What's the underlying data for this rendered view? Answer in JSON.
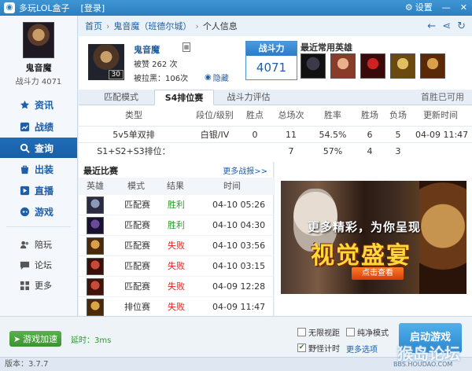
{
  "titlebar": {
    "title": "多玩LOL盒子",
    "login": "[登录]",
    "settings_label": "设置",
    "minimize": "—",
    "close": "✕"
  },
  "sidebar": {
    "player_name": "鬼音魔",
    "power_line": "战斗力 4071",
    "items": [
      {
        "label": "资讯",
        "icon": "star-icon"
      },
      {
        "label": "战绩",
        "icon": "chart-icon"
      },
      {
        "label": "查询",
        "icon": "search-icon",
        "active": true
      },
      {
        "label": "出装",
        "icon": "bag-icon"
      },
      {
        "label": "直播",
        "icon": "play-icon"
      },
      {
        "label": "游戏",
        "icon": "gamepad-icon"
      },
      {
        "label": "陪玩",
        "icon": "people-icon"
      },
      {
        "label": "论坛",
        "icon": "chat-icon"
      },
      {
        "label": "更多",
        "icon": "grid-icon"
      }
    ]
  },
  "breadcrumb": {
    "home": "首页",
    "server": "鬼音魔（班德尔城）",
    "current": "个人信息"
  },
  "player": {
    "name": "鬼音魔",
    "level": "30",
    "likes": "被赞 262 次",
    "blacklist": "被拉黑：106次",
    "hide_label": "隐藏",
    "power_title": "战斗力",
    "power_value": "4071",
    "heroes_title": "最近常用英雄"
  },
  "tabs": {
    "items": [
      "匹配模式",
      "S4排位赛",
      "战斗力评估"
    ],
    "active_index": 1,
    "note": "首胜已可用"
  },
  "stats": {
    "headers": [
      "类型",
      "段位/级别",
      "胜点",
      "总场次",
      "胜率",
      "胜场",
      "负场",
      "更新时间"
    ],
    "row1": [
      "5v5单双排",
      "白银/IV",
      "0",
      "11",
      "54.5%",
      "6",
      "5",
      "04-09 11:47"
    ],
    "row2": [
      "S1+S2+S3排位：",
      "",
      "",
      "7",
      "57%",
      "4",
      "3",
      ""
    ]
  },
  "recent": {
    "title": "最近比赛",
    "more": "更多战报>>",
    "columns": [
      "英雄",
      "模式",
      "结果",
      "时间"
    ],
    "matches": [
      {
        "mode": "匹配赛",
        "result": "胜利",
        "win": true,
        "time": "04-10 05:26"
      },
      {
        "mode": "匹配赛",
        "result": "胜利",
        "win": true,
        "time": "04-10 04:30"
      },
      {
        "mode": "匹配赛",
        "result": "失败",
        "win": false,
        "time": "04-10 03:56"
      },
      {
        "mode": "匹配赛",
        "result": "失败",
        "win": false,
        "time": "04-10 03:15"
      },
      {
        "mode": "匹配赛",
        "result": "失败",
        "win": false,
        "time": "04-09 12:28"
      },
      {
        "mode": "排位赛",
        "result": "失败",
        "win": false,
        "time": "04-09 11:47"
      }
    ]
  },
  "ad": {
    "tagline": "更多精彩，为你呈现",
    "headline": "视觉盛宴",
    "cta": "点击查看"
  },
  "bottom": {
    "accel_label": "游戏加速",
    "latency": "延时：3ms",
    "opt_windowed": "无限视距",
    "opt_pure": "纯净模式",
    "opt_timer": "野怪计时",
    "opt_timer_checked": true,
    "more_options": "更多选项",
    "start_label": "启动游戏"
  },
  "status": {
    "version": "版本：3.7.7"
  },
  "watermark": {
    "text": "猴岛论坛",
    "sub": "BBS.HOUDAO.COM"
  }
}
